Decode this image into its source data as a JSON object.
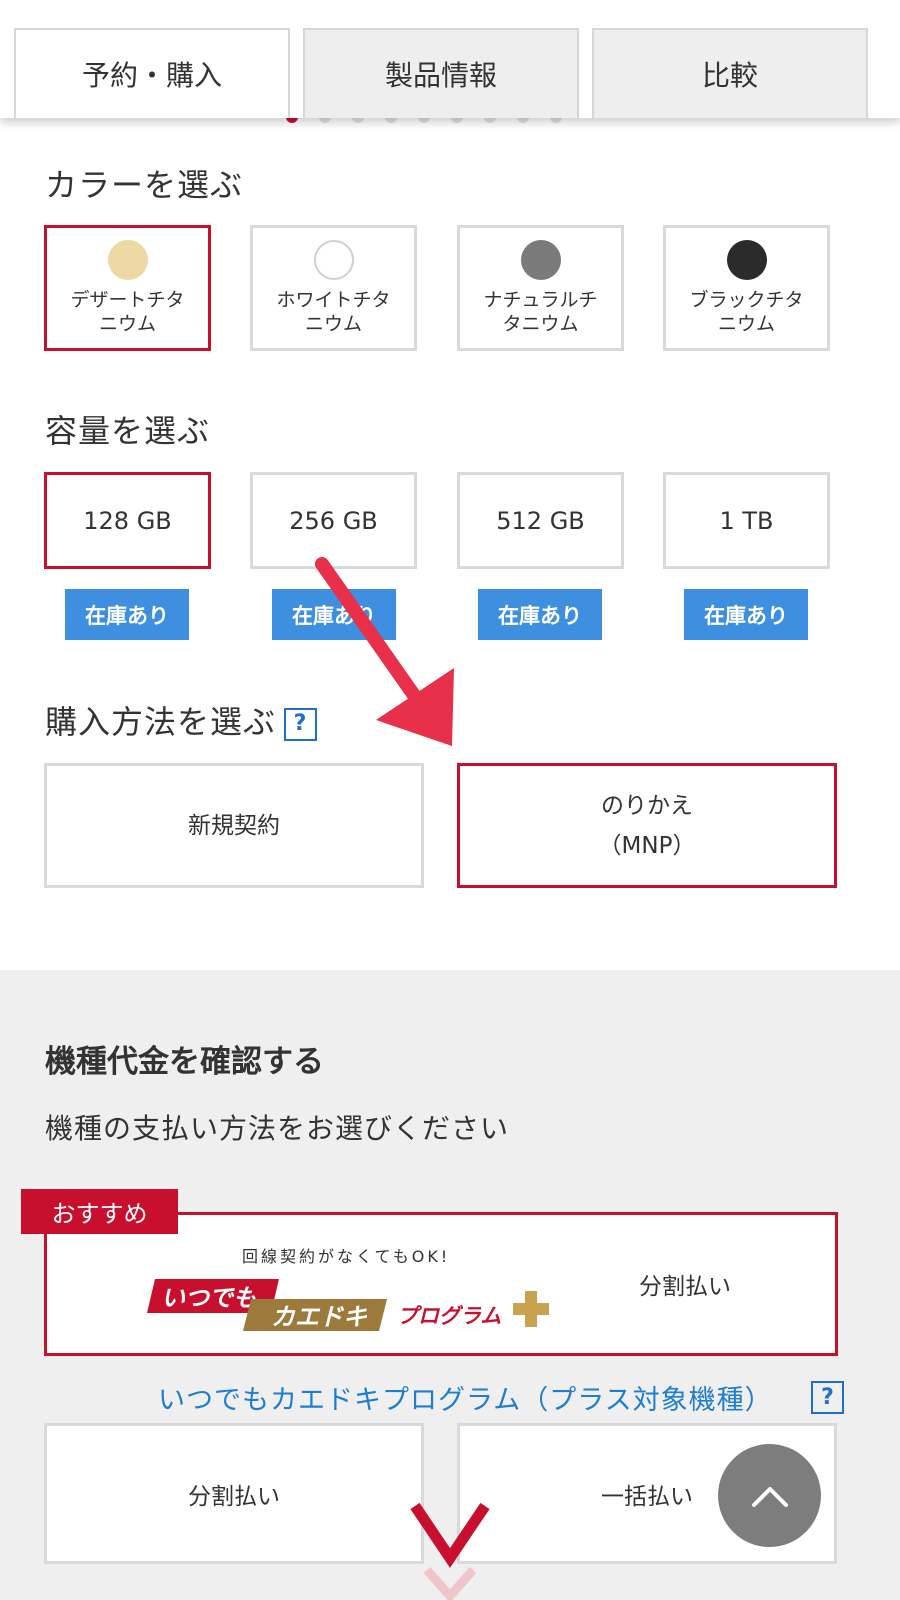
{
  "tabs": [
    {
      "label": "予約・購入",
      "active": true
    },
    {
      "label": "製品情報",
      "active": false
    },
    {
      "label": "比較",
      "active": false
    }
  ],
  "color_section": {
    "title": "カラーを選ぶ",
    "options": [
      {
        "name": "デザートチタニウム",
        "swatch": "#ecd9a3",
        "selected": true
      },
      {
        "name": "ホワイトチタニウム",
        "swatch": "#ffffff",
        "selected": false
      },
      {
        "name": "ナチュラルチタニウム",
        "swatch": "#7a7a7a",
        "selected": false
      },
      {
        "name": "ブラックチタニウム",
        "swatch": "#2b2b2b",
        "selected": false
      }
    ]
  },
  "capacity_section": {
    "title": "容量を選ぶ",
    "options": [
      {
        "label": "128 GB",
        "stock": "在庫あり",
        "selected": true
      },
      {
        "label": "256 GB",
        "stock": "在庫あり",
        "selected": false
      },
      {
        "label": "512 GB",
        "stock": "在庫あり",
        "selected": false
      },
      {
        "label": "1 TB",
        "stock": "在庫あり",
        "selected": false
      }
    ]
  },
  "purchase_section": {
    "title": "購入方法を選ぶ",
    "help_glyph": "?",
    "options": [
      {
        "label": "新規契約",
        "selected": false
      },
      {
        "label_line1": "のりかえ",
        "label_line2": "（MNP）",
        "selected": true
      }
    ]
  },
  "price_section": {
    "title": "機種代金を確認する",
    "subtitle": "機種の支払い方法をお選びください",
    "recommended": {
      "badge": "おすすめ",
      "tagline": "回線契約がなくてもOK!",
      "logo_part1": "いつでも",
      "logo_part2": "カエドキ",
      "logo_part3": "プログラム",
      "label": "分割払い"
    },
    "program_link": "いつでもカエドキプログラム（プラス対象機種）",
    "help_glyph": "?",
    "payments": [
      {
        "label": "分割払い"
      },
      {
        "label": "一括払い"
      }
    ]
  },
  "colors": {
    "accent_red": "#c8102e",
    "stock_blue": "#3f8fe0",
    "link_blue": "#1f7dd1",
    "annotation_red": "#e8304a"
  }
}
